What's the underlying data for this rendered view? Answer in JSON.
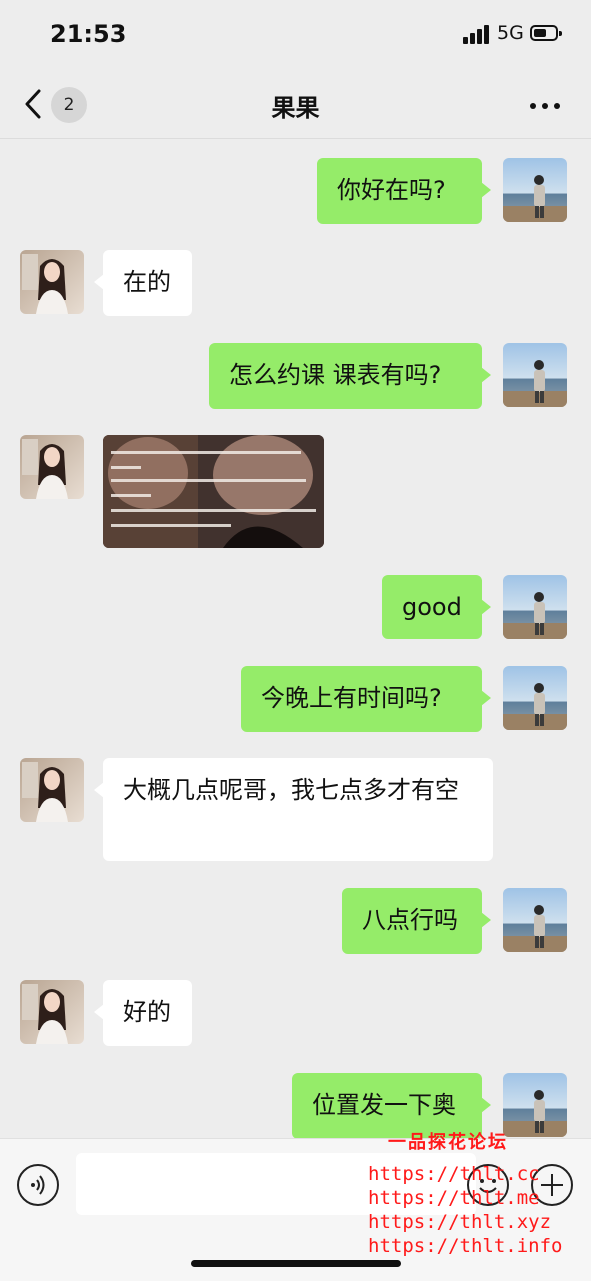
{
  "status_bar": {
    "time": "21:53",
    "network": "5G"
  },
  "nav": {
    "unread_count": "2",
    "title": "果果"
  },
  "messages": [
    {
      "side": "out",
      "text": "你好在吗?"
    },
    {
      "side": "in",
      "text": "在的"
    },
    {
      "side": "out",
      "text": "怎么约课 课表有吗?"
    },
    {
      "side": "in",
      "type": "image"
    },
    {
      "side": "out",
      "text": "good"
    },
    {
      "side": "out",
      "text": "今晚上有时间吗?"
    },
    {
      "side": "in",
      "text": "大概几点呢哥，我七点多才有空"
    },
    {
      "side": "out",
      "text": "八点行吗"
    },
    {
      "side": "in",
      "text": "好的"
    },
    {
      "side": "out",
      "text": "位置发一下奥"
    }
  ],
  "input": {
    "placeholder": ""
  },
  "watermark": {
    "title": "一品探花论坛",
    "urls": [
      "https://thlt.cc",
      "https://thlt.me",
      "https://thlt.xyz",
      "https://thlt.info"
    ]
  },
  "colors": {
    "outgoing_bubble": "#95ec69",
    "incoming_bubble": "#ffffff",
    "background": "#ededed",
    "watermark": "#ff1a1a"
  }
}
